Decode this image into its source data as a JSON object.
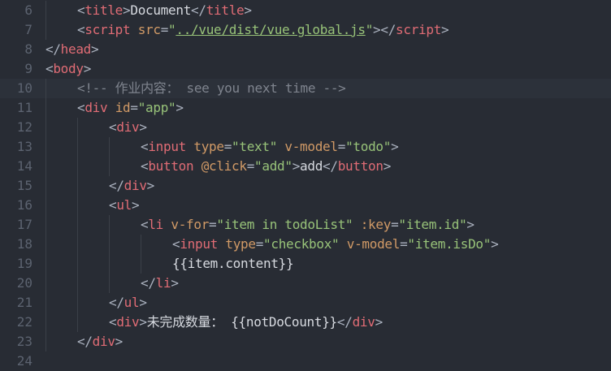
{
  "editor": {
    "language": "html",
    "colors": {
      "background": "#282c34",
      "gutter": "#5c6370",
      "tag": "#e06c75",
      "attribute": "#d19a66",
      "string": "#98c379",
      "comment": "#7f848e",
      "text": "#d7dae0",
      "punctuation": "#abb2bf"
    },
    "current_line": 10,
    "lines": [
      {
        "n": "6",
        "indent": 1,
        "tokens": [
          {
            "t": "<",
            "c": "punct"
          },
          {
            "t": "title",
            "c": "tag"
          },
          {
            "t": ">",
            "c": "punct"
          },
          {
            "t": "Document",
            "c": "text"
          },
          {
            "t": "</",
            "c": "punct"
          },
          {
            "t": "title",
            "c": "tag"
          },
          {
            "t": ">",
            "c": "punct"
          }
        ]
      },
      {
        "n": "7",
        "indent": 1,
        "tokens": [
          {
            "t": "<",
            "c": "punct"
          },
          {
            "t": "script",
            "c": "tag"
          },
          {
            "t": " ",
            "c": "punct"
          },
          {
            "t": "src",
            "c": "attr"
          },
          {
            "t": "=",
            "c": "punct"
          },
          {
            "t": "\"",
            "c": "str"
          },
          {
            "t": "../vue/dist/vue.global.js",
            "c": "str",
            "link": true
          },
          {
            "t": "\"",
            "c": "str"
          },
          {
            "t": "></",
            "c": "punct"
          },
          {
            "t": "script",
            "c": "tag"
          },
          {
            "t": ">",
            "c": "punct"
          }
        ]
      },
      {
        "n": "8",
        "indent": 0,
        "tokens": [
          {
            "t": "</",
            "c": "punct"
          },
          {
            "t": "head",
            "c": "tag"
          },
          {
            "t": ">",
            "c": "punct"
          }
        ]
      },
      {
        "n": "9",
        "indent": 0,
        "tokens": [
          {
            "t": "<",
            "c": "punct"
          },
          {
            "t": "body",
            "c": "tag"
          },
          {
            "t": ">",
            "c": "punct"
          }
        ]
      },
      {
        "n": "10",
        "indent": 1,
        "tokens": [
          {
            "t": "<!-- 作业内容： see you next time -->",
            "c": "comment"
          }
        ]
      },
      {
        "n": "11",
        "indent": 1,
        "tokens": [
          {
            "t": "<",
            "c": "punct"
          },
          {
            "t": "div",
            "c": "tag"
          },
          {
            "t": " ",
            "c": "punct"
          },
          {
            "t": "id",
            "c": "attr"
          },
          {
            "t": "=",
            "c": "punct"
          },
          {
            "t": "\"app\"",
            "c": "str"
          },
          {
            "t": ">",
            "c": "punct"
          }
        ]
      },
      {
        "n": "12",
        "indent": 2,
        "tokens": [
          {
            "t": "<",
            "c": "punct"
          },
          {
            "t": "div",
            "c": "tag"
          },
          {
            "t": ">",
            "c": "punct"
          }
        ]
      },
      {
        "n": "13",
        "indent": 3,
        "tokens": [
          {
            "t": "<",
            "c": "punct"
          },
          {
            "t": "input",
            "c": "tag"
          },
          {
            "t": " ",
            "c": "punct"
          },
          {
            "t": "type",
            "c": "attr"
          },
          {
            "t": "=",
            "c": "punct"
          },
          {
            "t": "\"text\"",
            "c": "str"
          },
          {
            "t": " ",
            "c": "punct"
          },
          {
            "t": "v-model",
            "c": "attr"
          },
          {
            "t": "=",
            "c": "punct"
          },
          {
            "t": "\"todo\"",
            "c": "str"
          },
          {
            "t": ">",
            "c": "punct"
          }
        ]
      },
      {
        "n": "14",
        "indent": 3,
        "tokens": [
          {
            "t": "<",
            "c": "punct"
          },
          {
            "t": "button",
            "c": "tag"
          },
          {
            "t": " ",
            "c": "punct"
          },
          {
            "t": "@click",
            "c": "attr"
          },
          {
            "t": "=",
            "c": "punct"
          },
          {
            "t": "\"add\"",
            "c": "str"
          },
          {
            "t": ">",
            "c": "punct"
          },
          {
            "t": "add",
            "c": "text"
          },
          {
            "t": "</",
            "c": "punct"
          },
          {
            "t": "button",
            "c": "tag"
          },
          {
            "t": ">",
            "c": "punct"
          }
        ]
      },
      {
        "n": "15",
        "indent": 2,
        "tokens": [
          {
            "t": "</",
            "c": "punct"
          },
          {
            "t": "div",
            "c": "tag"
          },
          {
            "t": ">",
            "c": "punct"
          }
        ]
      },
      {
        "n": "16",
        "indent": 2,
        "tokens": [
          {
            "t": "<",
            "c": "punct"
          },
          {
            "t": "ul",
            "c": "tag"
          },
          {
            "t": ">",
            "c": "punct"
          }
        ]
      },
      {
        "n": "17",
        "indent": 3,
        "tokens": [
          {
            "t": "<",
            "c": "punct"
          },
          {
            "t": "li",
            "c": "tag"
          },
          {
            "t": " ",
            "c": "punct"
          },
          {
            "t": "v-for",
            "c": "attr"
          },
          {
            "t": "=",
            "c": "punct"
          },
          {
            "t": "\"item in todoList\"",
            "c": "str"
          },
          {
            "t": " ",
            "c": "punct"
          },
          {
            "t": ":key",
            "c": "attr"
          },
          {
            "t": "=",
            "c": "punct"
          },
          {
            "t": "\"item.id\"",
            "c": "str"
          },
          {
            "t": ">",
            "c": "punct"
          }
        ]
      },
      {
        "n": "18",
        "indent": 4,
        "tokens": [
          {
            "t": "<",
            "c": "punct"
          },
          {
            "t": "input",
            "c": "tag"
          },
          {
            "t": " ",
            "c": "punct"
          },
          {
            "t": "type",
            "c": "attr"
          },
          {
            "t": "=",
            "c": "punct"
          },
          {
            "t": "\"checkbox\"",
            "c": "str"
          },
          {
            "t": " ",
            "c": "punct"
          },
          {
            "t": "v-model",
            "c": "attr"
          },
          {
            "t": "=",
            "c": "punct"
          },
          {
            "t": "\"item.isDo\"",
            "c": "str"
          },
          {
            "t": ">",
            "c": "punct"
          }
        ]
      },
      {
        "n": "19",
        "indent": 4,
        "tokens": [
          {
            "t": "{{item.content}}",
            "c": "text"
          }
        ]
      },
      {
        "n": "20",
        "indent": 3,
        "tokens": [
          {
            "t": "</",
            "c": "punct"
          },
          {
            "t": "li",
            "c": "tag"
          },
          {
            "t": ">",
            "c": "punct"
          }
        ]
      },
      {
        "n": "21",
        "indent": 2,
        "tokens": [
          {
            "t": "</",
            "c": "punct"
          },
          {
            "t": "ul",
            "c": "tag"
          },
          {
            "t": ">",
            "c": "punct"
          }
        ]
      },
      {
        "n": "22",
        "indent": 2,
        "tokens": [
          {
            "t": "<",
            "c": "punct"
          },
          {
            "t": "div",
            "c": "tag"
          },
          {
            "t": ">",
            "c": "punct"
          },
          {
            "t": "未完成数量： {{notDoCount}}",
            "c": "text"
          },
          {
            "t": "</",
            "c": "punct"
          },
          {
            "t": "div",
            "c": "tag"
          },
          {
            "t": ">",
            "c": "punct"
          }
        ]
      },
      {
        "n": "23",
        "indent": 1,
        "tokens": [
          {
            "t": "</",
            "c": "punct"
          },
          {
            "t": "div",
            "c": "tag"
          },
          {
            "t": ">",
            "c": "punct"
          }
        ]
      },
      {
        "n": "24",
        "indent": 0,
        "tokens": []
      }
    ]
  }
}
